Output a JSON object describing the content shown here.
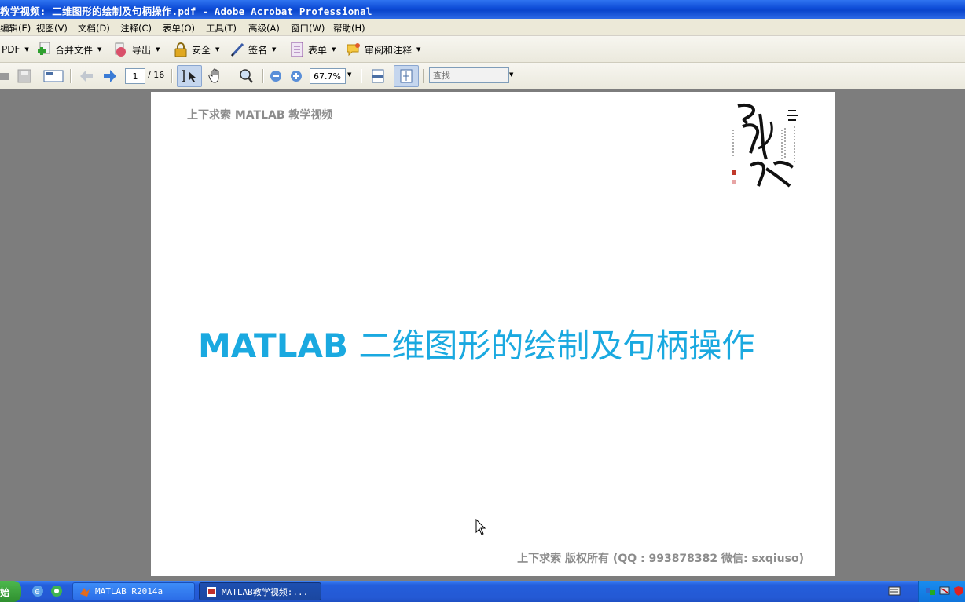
{
  "window": {
    "title": "教学视频: 二维图形的绘制及句柄操作.pdf - Adobe Acrobat Professional"
  },
  "menu": {
    "items": [
      "编辑(E)",
      "视图(V)",
      "文档(D)",
      "注释(C)",
      "表单(O)",
      "工具(T)",
      "高级(A)",
      "窗口(W)",
      "帮助(H)"
    ]
  },
  "toolbar1": {
    "create_pdf": "PDF",
    "combine": "合并文件",
    "export": "导出",
    "secure": "安全",
    "sign": "签名",
    "forms": "表单",
    "review": "审阅和注释"
  },
  "toolbar2": {
    "page_value": "1",
    "page_total": "/ 16",
    "zoom_value": "67.7%",
    "search_placeholder": "查找"
  },
  "document": {
    "header": "上下求索 MATLAB 教学视频",
    "title_latin": "MATLAB",
    "title_cjk": "二维图形的绘制及句柄操作",
    "footer": "上下求索 版权所有 (QQ : 993878382  微信: sxqiuso)"
  },
  "taskbar": {
    "start_label": "始",
    "tasks": [
      "MATLAB R2014a",
      "MATLAB教学视频:..."
    ]
  },
  "colors": {
    "title_blue": "#1aa9e0",
    "titlebar": "#0d4bd6",
    "workspace": "#7d7d7d"
  }
}
